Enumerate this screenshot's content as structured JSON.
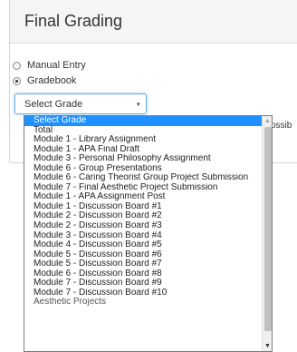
{
  "panel": {
    "title": "Final Grading"
  },
  "entry_mode": {
    "options": [
      {
        "label": "Manual Entry",
        "checked": false
      },
      {
        "label": "Gradebook",
        "checked": true
      }
    ]
  },
  "grade_select": {
    "value": "Select Grade",
    "options": [
      "Select Grade",
      "Total",
      "Module 1 - Library Assignment",
      "Module 1 - APA Final Draft",
      "Module 3 - Personal Philosophy Assignment",
      "Module 6 - Group Presentations",
      "Module 6 - Caring Theorist Group Project Submission",
      "Module 7 - Final Aesthetic Project Submission",
      "Module 1 - APA Assignment Post",
      "Module 1 - Discussion Board #1",
      "Module 2 - Discussion Board #2",
      "Module 2 - Discussion Board #3",
      "Module 3 - Discussion Board #4",
      "Module 4 - Discussion Board #5",
      "Module 5 - Discussion Board #6",
      "Module 5 - Discussion Board #7",
      "Module 6 - Discussion Board #8",
      "Module 7 - Discussion Board #9",
      "Module 7 - Discussion Board #10",
      "Aesthetic Projects"
    ]
  },
  "background_partial_text": "ossib",
  "icons": {
    "select_arrow": "▾",
    "scroll_up": "▲",
    "scroll_down": "▼"
  },
  "colors": {
    "highlight": "#1e90ff",
    "focus_border": "#66afe9"
  }
}
